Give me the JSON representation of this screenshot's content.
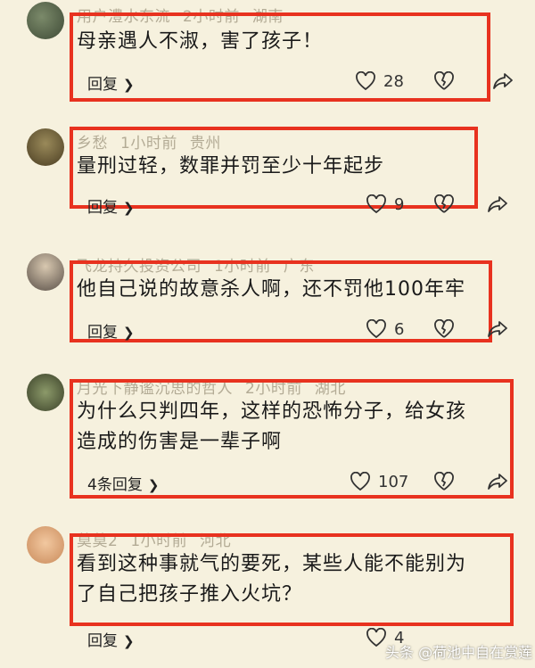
{
  "comments": [
    {
      "user": "用户澧水东流",
      "time": "2小时前",
      "location": "湖南",
      "text": "母亲遇人不淑，害了孩子！",
      "reply_label": "回复",
      "likes": "28"
    },
    {
      "user": "乡愁",
      "time": "1小时前",
      "location": "贵州",
      "text": "量刑过轻，数罪并罚至少十年起步",
      "reply_label": "回复",
      "likes": "9"
    },
    {
      "user": "飞龙持久投资公司",
      "time": "1小时前",
      "location": "广东",
      "text": "他自己说的故意杀人啊，还不罚他100年牢",
      "reply_label": "回复",
      "likes": "6"
    },
    {
      "user": "月光下静谧沉思的哲人",
      "time": "2小时前",
      "location": "湖北",
      "text": "为什么只判四年，这样的恐怖分子，给女孩\n造成的伤害是一辈子啊",
      "reply_label": "4条回复",
      "likes": "107"
    },
    {
      "user": "莫莫2",
      "time": "1小时前",
      "location": "河北",
      "text": "看到这种事就气的要死，某些人能不能别为\n了自己把孩子推入火坑？",
      "reply_label": "回复",
      "likes": "4"
    }
  ],
  "watermark": "头条 @荷池中自在赏莲",
  "colors": {
    "highlight_box": "#e8321f",
    "background": "#f6f1de",
    "meta_text": "#b3ab95"
  }
}
